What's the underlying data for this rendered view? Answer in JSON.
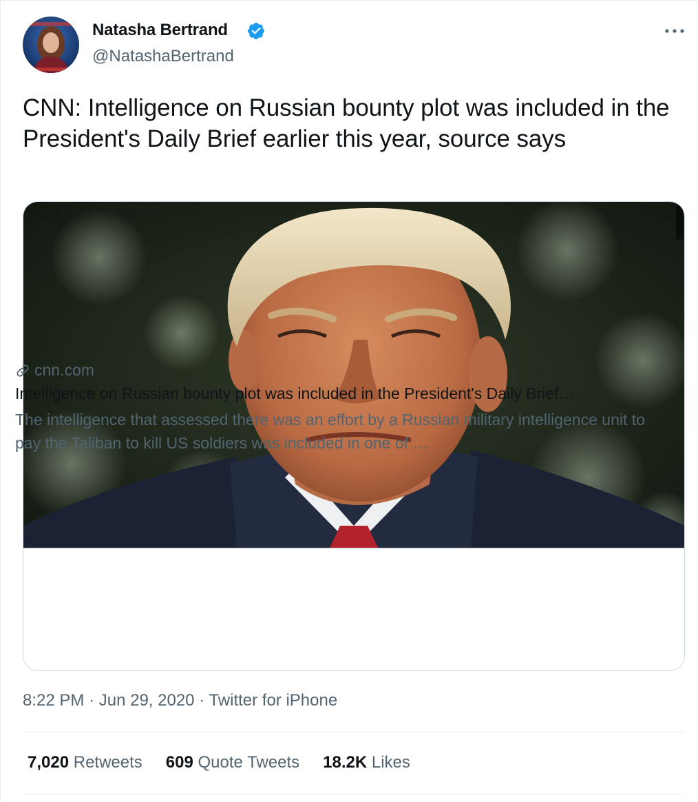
{
  "author": {
    "display_name": "Natasha Bertrand",
    "handle": "@NatashaBertrand",
    "verified": true
  },
  "tweet": {
    "text": "CNN: Intelligence on Russian bounty plot was included in the President's Daily Brief earlier this year, source says"
  },
  "link_card": {
    "domain": "cnn.com",
    "title": "Intelligence on Russian bounty plot was included in the President's Daily Brief…",
    "description": "The intelligence that assessed there was an effort by a Russian military intelligence unit to pay the Taliban to kill US soldiers was included in one of …"
  },
  "meta": {
    "time": "8:22 PM",
    "date": "Jun 29, 2020",
    "source": "Twitter for iPhone",
    "separator": "·"
  },
  "stats": {
    "retweets_count": "7,020",
    "retweets_label": "Retweets",
    "quotes_count": "609",
    "quotes_label": "Quote Tweets",
    "likes_count": "18.2K",
    "likes_label": "Likes"
  },
  "icons": {
    "verified": "verified-badge-icon",
    "more": "more-dots-icon",
    "link": "link-icon"
  },
  "colors": {
    "verified_blue": "#1d9bf0",
    "secondary_text": "#536471",
    "primary_text": "#0f1419"
  }
}
